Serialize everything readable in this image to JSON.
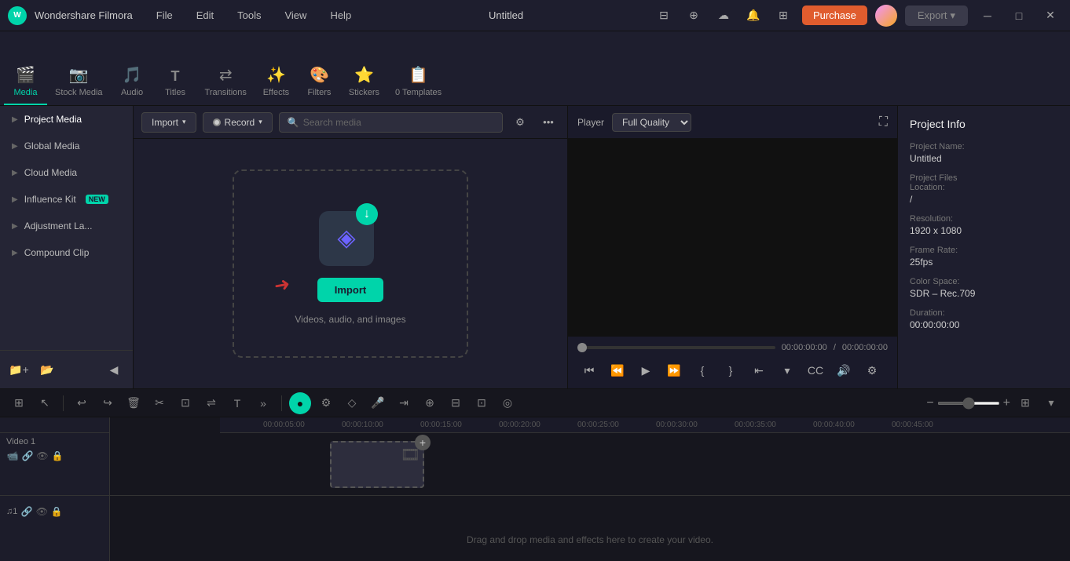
{
  "titlebar": {
    "app_name": "Wondershare Filmora",
    "title": "Untitled",
    "menu": [
      "File",
      "Edit",
      "Tools",
      "View",
      "Help"
    ],
    "purchase_label": "Purchase",
    "export_label": "Export"
  },
  "tabs": [
    {
      "id": "media",
      "label": "Media",
      "icon": "🎬",
      "active": true
    },
    {
      "id": "stock_media",
      "label": "Stock Media",
      "icon": "📷"
    },
    {
      "id": "audio",
      "label": "Audio",
      "icon": "🎵"
    },
    {
      "id": "titles",
      "label": "Titles",
      "icon": "T"
    },
    {
      "id": "transitions",
      "label": "Transitions",
      "icon": "↔"
    },
    {
      "id": "effects",
      "label": "Effects",
      "icon": "✨"
    },
    {
      "id": "filters",
      "label": "Filters",
      "icon": "🎨"
    },
    {
      "id": "stickers",
      "label": "Stickers",
      "icon": "⭐"
    },
    {
      "id": "templates",
      "label": "Templates",
      "icon": "📋",
      "count": "0 Templates"
    }
  ],
  "media_panel": {
    "items": [
      {
        "id": "project_media",
        "label": "Project Media",
        "active": true
      },
      {
        "id": "global_media",
        "label": "Global Media"
      },
      {
        "id": "cloud_media",
        "label": "Cloud Media"
      },
      {
        "id": "influence_kit",
        "label": "Influence Kit",
        "badge": "NEW"
      },
      {
        "id": "adjustment_layer",
        "label": "Adjustment La..."
      },
      {
        "id": "compound_clip",
        "label": "Compound Clip"
      }
    ]
  },
  "import_toolbar": {
    "import_label": "Import",
    "record_label": "Record",
    "search_placeholder": "Search media"
  },
  "drop_zone": {
    "import_btn_label": "Import",
    "subtitle": "Videos, audio, and images"
  },
  "player": {
    "label": "Player",
    "quality": "Full Quality",
    "time_current": "00:00:00:00",
    "time_total": "00:00:00:00"
  },
  "project_info": {
    "title": "Project Info",
    "project_name_label": "Project Name:",
    "project_name_value": "Untitled",
    "project_files_label": "Project Files\nLocation:",
    "project_files_value": "/",
    "resolution_label": "Resolution:",
    "resolution_value": "1920 x 1080",
    "frame_rate_label": "Frame Rate:",
    "frame_rate_value": "25fps",
    "color_space_label": "Color Space:",
    "color_space_value": "SDR – Rec.709",
    "duration_label": "Duration:",
    "duration_value": "00:00:00:00"
  },
  "timeline": {
    "ruler_marks": [
      "00:00:05:00",
      "00:00:10:00",
      "00:00:15:00",
      "00:00:20:00",
      "00:00:25:00",
      "00:00:30:00",
      "00:00:35:00",
      "00:00:40:00",
      "00:00:45:00"
    ],
    "drag_drop_label": "Drag and drop media and effects here to create your video.",
    "video_track_label": "Video 1",
    "audio_track_label": "♫1"
  }
}
